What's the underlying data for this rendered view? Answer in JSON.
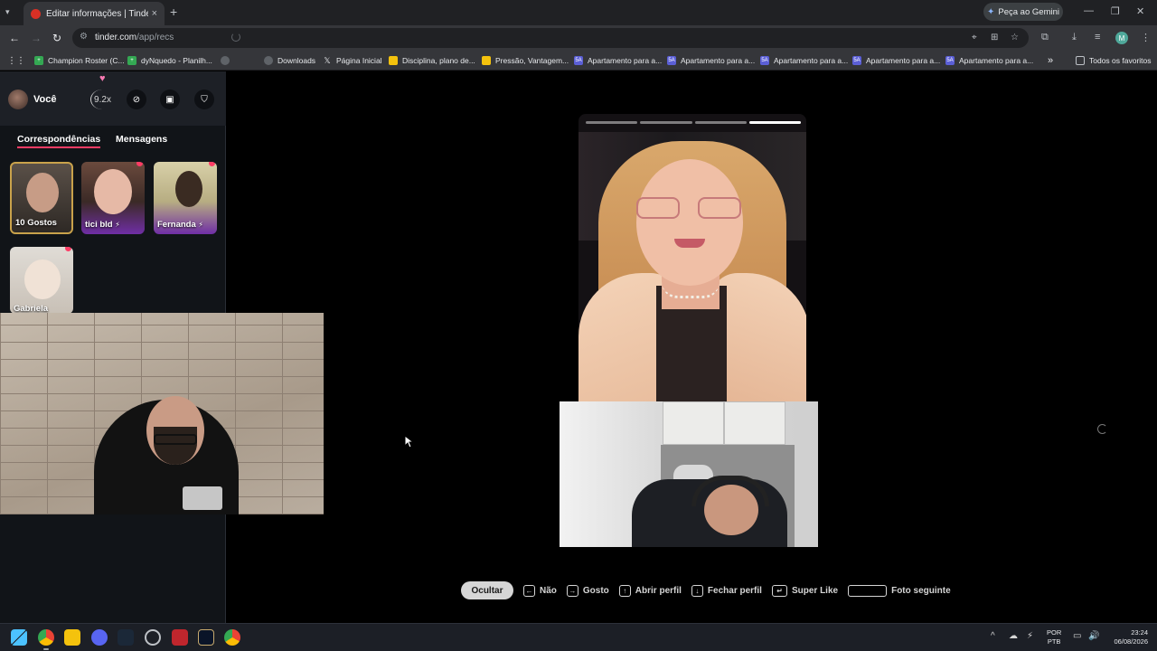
{
  "browser": {
    "tab_title": "Editar informações | Tinder",
    "tab_close": "×",
    "new_tab": "+",
    "tab_list": "▾",
    "gemini_label": "Peça ao Gemini",
    "url_host": "tinder.com",
    "url_path": "/app/recs",
    "window_controls": {
      "minimize": "—",
      "restore": "❐",
      "close": "✕"
    },
    "profile_initial": "M"
  },
  "bookmarks": [
    {
      "label": "Champion Roster (C...",
      "color": "#34a853",
      "glyph": "+"
    },
    {
      "label": "dyNquedo - Planilh...",
      "color": "#34a853",
      "glyph": "+"
    },
    {
      "label": "",
      "color": "#5f6368",
      "glyph": "◎"
    },
    {
      "label": "Downloads",
      "color": "#5f6368",
      "glyph": "◎"
    },
    {
      "label": "Página Inicial",
      "color": "#000000",
      "glyph": "X"
    },
    {
      "label": "Disciplina, plano de...",
      "color": "#f4c20d",
      "glyph": ""
    },
    {
      "label": "Pressão, Vantagem...",
      "color": "#f4c20d",
      "glyph": ""
    },
    {
      "label": "Apartamento para a...",
      "color": "#5b5fd6",
      "glyph": "5A"
    },
    {
      "label": "Apartamento para a...",
      "color": "#5b5fd6",
      "glyph": "5A"
    },
    {
      "label": "Apartamento para a...",
      "color": "#5b5fd6",
      "glyph": "5A"
    },
    {
      "label": "Apartamento para a...",
      "color": "#5b5fd6",
      "glyph": "5A"
    },
    {
      "label": "Apartamento para a...",
      "color": "#5b5fd6",
      "glyph": "5A"
    }
  ],
  "bookmarks_overflow": "»",
  "bookmarks_all": "Todos os favoritos",
  "sidebar": {
    "user_label": "Você",
    "boost_multiplier": "9.2x",
    "tabs": {
      "matches": "Correspondências",
      "messages": "Mensagens"
    },
    "matches": [
      {
        "name": "10 Gostos",
        "super": false,
        "new": false
      },
      {
        "name": "tici bld",
        "super": true,
        "new": true
      },
      {
        "name": "Fernanda",
        "super": true,
        "new": true
      },
      {
        "name": "Gabriela",
        "super": false,
        "new": true
      }
    ],
    "super_glyph": "⚡"
  },
  "card": {
    "photo_count": 4,
    "active_photo": 4
  },
  "hints": {
    "hide": "Ocultar",
    "no": "Não",
    "like": "Gosto",
    "open_profile": "Abrir perfil",
    "close_profile": "Fechar perfil",
    "super_like": "Super Like",
    "next_photo": "Foto seguinte",
    "keys": {
      "left": "←",
      "right": "→",
      "up": "↑",
      "down": "↓",
      "enter": "↵"
    }
  },
  "taskbar": {
    "lang_line1": "POR",
    "lang_line2": "PTB",
    "time": "23:24",
    "date": "06/08/2026",
    "tray_up": "^"
  },
  "colors": {
    "tinder_accent": "#fd3c65",
    "chrome_dark": "#202124",
    "chrome_toolbar": "#35363a"
  }
}
